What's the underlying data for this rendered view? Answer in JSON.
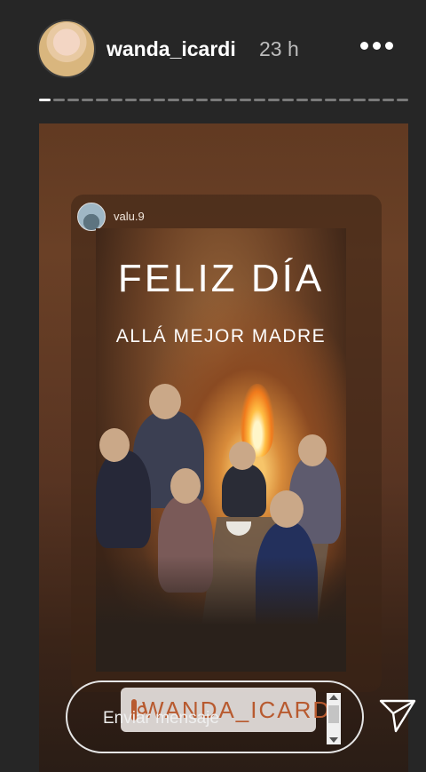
{
  "header": {
    "username": "wanda_icardi",
    "time": "23 h",
    "more_icon": "more-horizontal-icon"
  },
  "progress": {
    "segments": 26,
    "active_index": 0
  },
  "repost": {
    "username": "valu.9",
    "title_line1": "FELIZ DÍA",
    "title_line2": "ALLÁ MEJOR MADRE"
  },
  "sticker": {
    "text": "WANDA_ICARDI",
    "icon": "instagram-icon"
  },
  "reply": {
    "placeholder": "Enviar mensaje"
  },
  "send_icon": "paper-plane-icon",
  "colors": {
    "background": "#262626",
    "sticker_text": "#b85a2f"
  }
}
